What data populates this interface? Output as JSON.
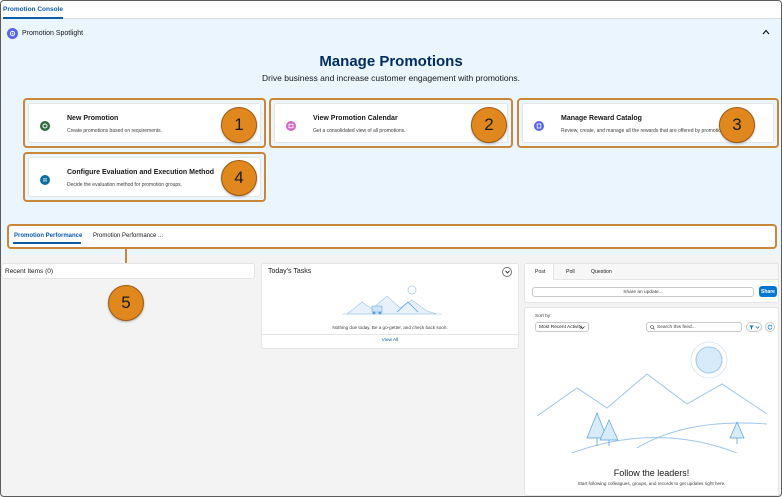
{
  "app": {
    "tab_label": "Promotion Console"
  },
  "spotlight": {
    "title": "Promotion Spotlight",
    "heading": "Manage Promotions",
    "subheading": "Drive business and increase customer engagement with promotions."
  },
  "cards": [
    {
      "title": "New Promotion",
      "desc": "Create promotions based on requirements.",
      "icon": "promotion-icon",
      "color": "#3a7a3a",
      "badge": "1"
    },
    {
      "title": "View Promotion Calendar",
      "desc": "Get a consolidated view of all promotions.",
      "icon": "calendar-icon",
      "color": "#d16cc6",
      "badge": "2"
    },
    {
      "title": "Manage Reward Catalog",
      "desc": "Review, create, and manage all the rewards that are offered by promotions.",
      "icon": "catalog-icon",
      "color": "#5867e8",
      "badge": "3"
    },
    {
      "title": "Configure Evaluation and Execution Method",
      "desc": "Decide the evaluation method for promotion groups.",
      "icon": "settings-icon",
      "color": "#0b6e9c",
      "badge": "4"
    }
  ],
  "performance_tabs": {
    "active": "Promotion Performance",
    "second": "Promotion Performance ...",
    "badge": "5"
  },
  "recent_items": {
    "label": "Recent Items (0)"
  },
  "tasks": {
    "title": "Today's Tasks",
    "empty_message": "Nothing due today. Be a go-getter, and check back soon.",
    "view_all": "View All"
  },
  "feed": {
    "tabs": [
      "Post",
      "Poll",
      "Question"
    ],
    "share_placeholder": "Share an update...",
    "share_button": "Share",
    "sort_label": "Sort by:",
    "sort_value": "Most Recent Activity",
    "search_placeholder": "Search this feed...",
    "empty_title": "Follow the leaders!",
    "empty_subtitle": "Start following colleagues, groups, and records to get updates right here."
  },
  "colors": {
    "brand_blue": "#0b5cab",
    "spotlight_bg": "#eaf5fe",
    "callout_orange": "#e0881e",
    "button_blue": "#0176d3"
  }
}
